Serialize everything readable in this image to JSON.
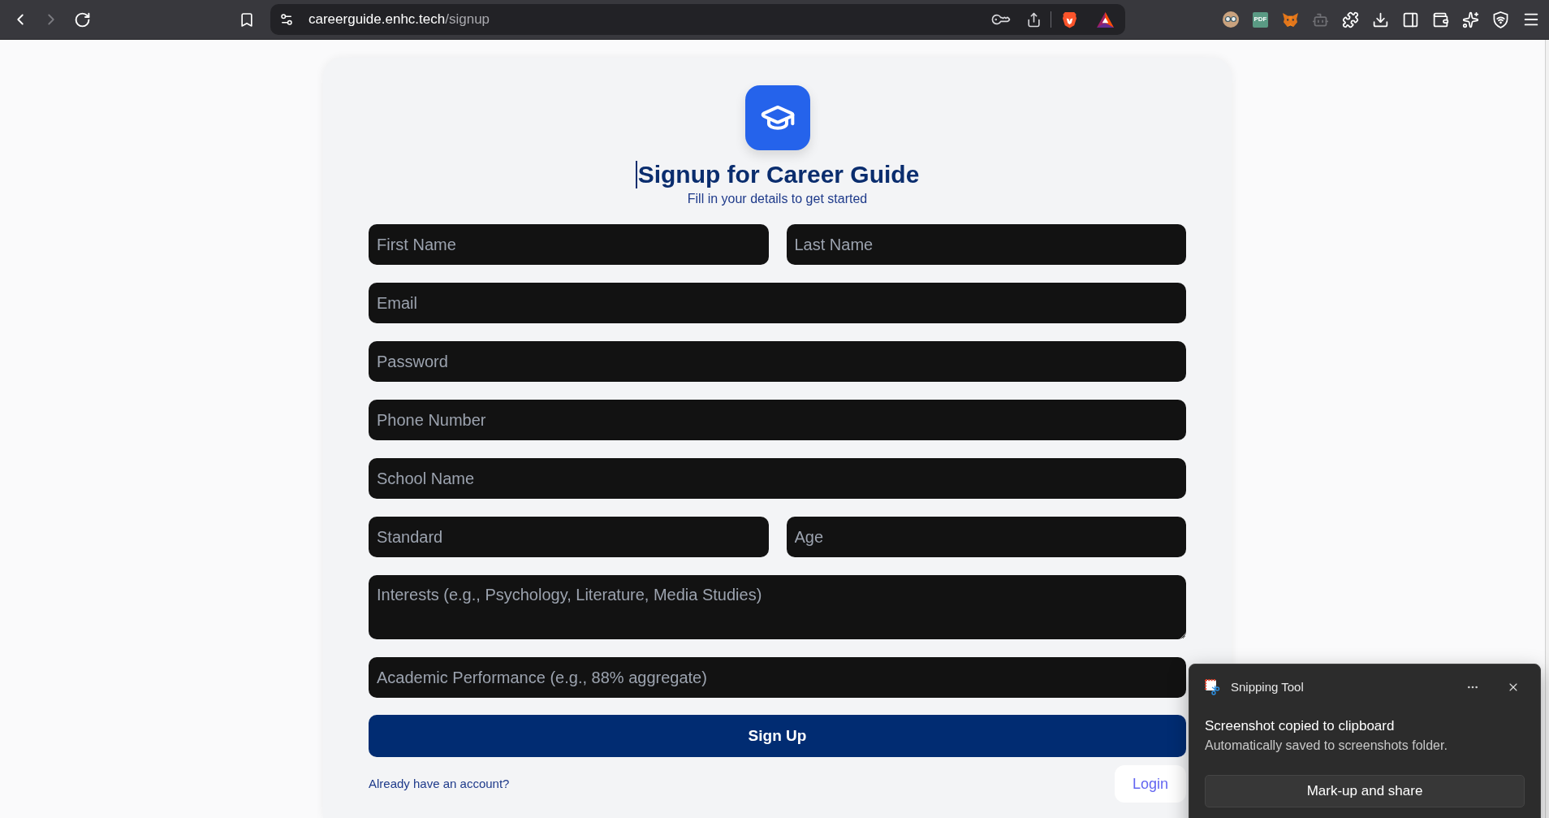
{
  "browser": {
    "url": {
      "host": "careerguide.enhc.tech",
      "path": "/signup"
    },
    "forward_disabled": true,
    "pdf_label": "PDF"
  },
  "header": {
    "title": "Signup for Career Guide",
    "subtitle": "Fill in your details to get started"
  },
  "form": {
    "rows": [
      [
        {
          "kind": "input",
          "placeholder": "First Name"
        },
        {
          "kind": "input",
          "placeholder": "Last Name"
        }
      ],
      [
        {
          "kind": "input",
          "placeholder": "Email"
        }
      ],
      [
        {
          "kind": "input",
          "placeholder": "Password"
        }
      ],
      [
        {
          "kind": "input",
          "placeholder": "Phone Number"
        }
      ],
      [
        {
          "kind": "input",
          "placeholder": "School Name"
        }
      ],
      [
        {
          "kind": "input",
          "placeholder": "Standard"
        },
        {
          "kind": "input",
          "placeholder": "Age"
        }
      ],
      [
        {
          "kind": "textarea",
          "placeholder": "Interests (e.g., Psychology, Literature, Media Studies)"
        }
      ],
      [
        {
          "kind": "input",
          "placeholder": "Academic Performance (e.g., 88% aggregate)"
        }
      ]
    ],
    "submit": "Sign Up"
  },
  "footer": {
    "prompt": "Already have an account?",
    "login": "Login"
  },
  "notification": {
    "app": "Snipping Tool",
    "title": "Screenshot copied to clipboard",
    "body": "Automatically saved to screenshots folder.",
    "action": "Mark-up and share"
  }
}
